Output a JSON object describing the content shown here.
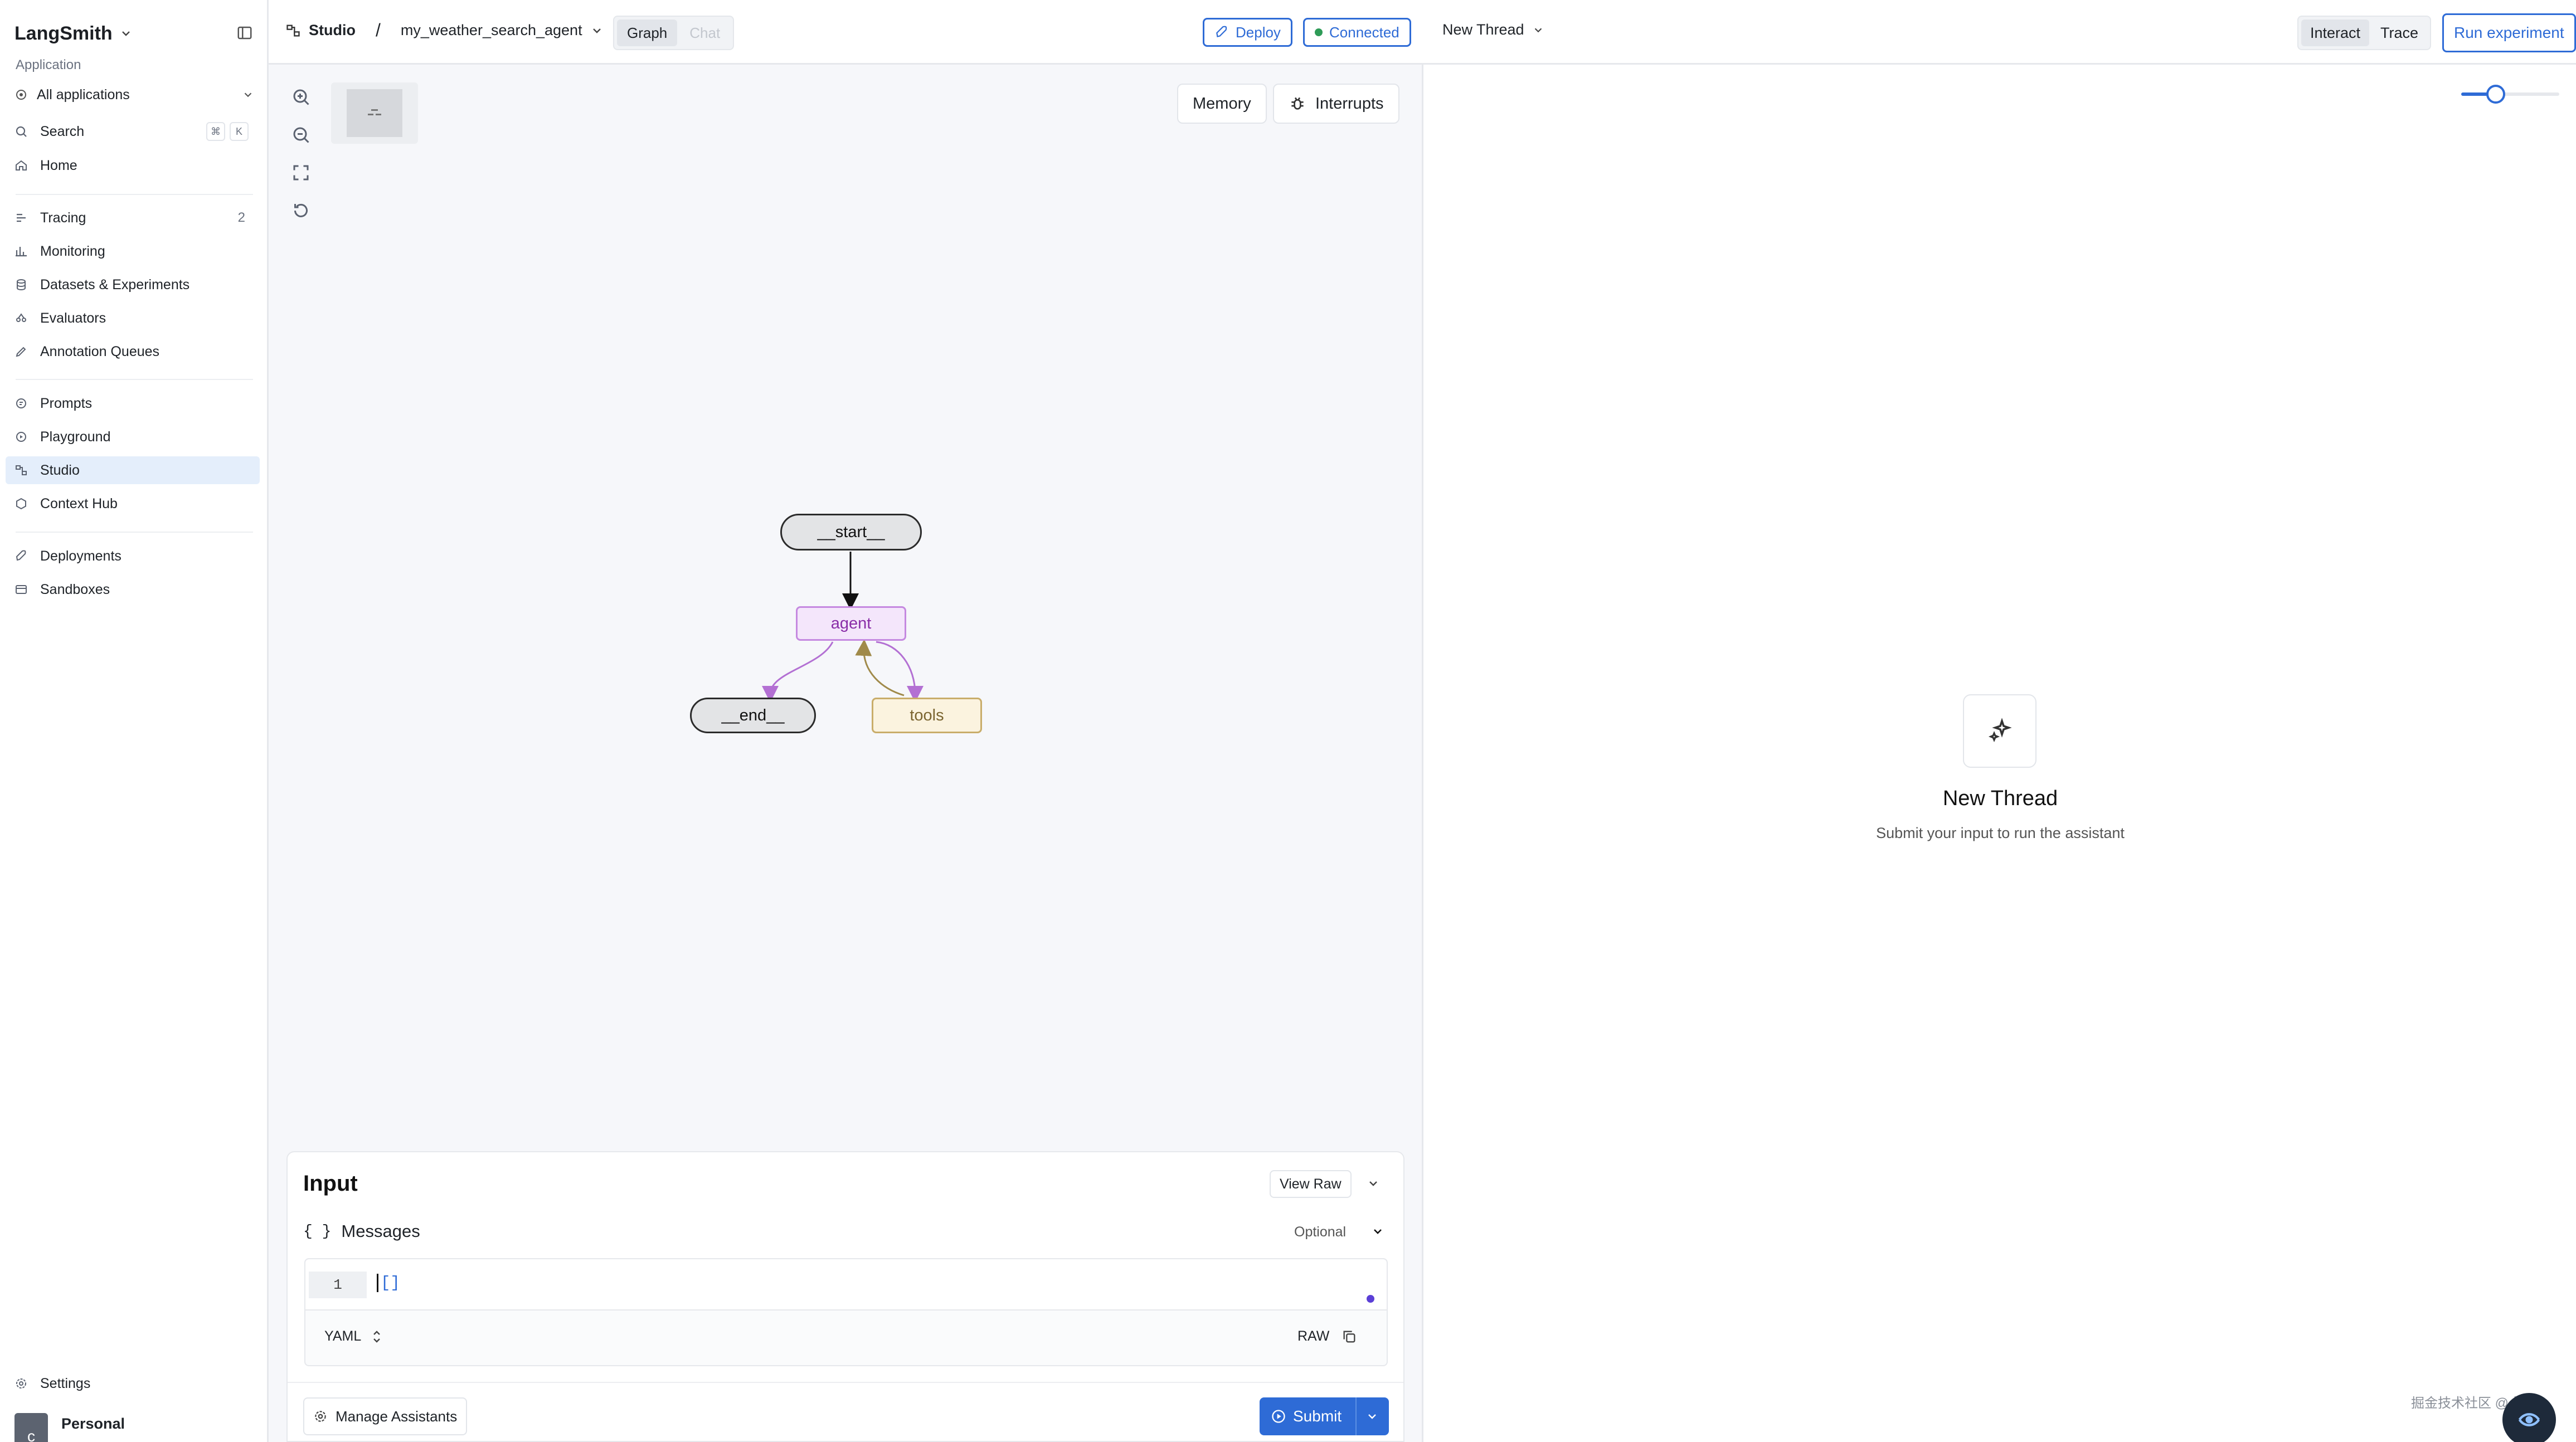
{
  "sidebar": {
    "brand": "LangSmith",
    "section_label": "Application",
    "app_selector": "All applications",
    "search": {
      "label": "Search",
      "kbd1": "⌘",
      "kbd2": "K"
    },
    "home": "Home",
    "tracing": {
      "label": "Tracing",
      "badge": "2"
    },
    "monitoring": "Monitoring",
    "datasets": "Datasets & Experiments",
    "evaluators": "Evaluators",
    "annotation": "Annotation Queues",
    "prompts": "Prompts",
    "playground": "Playground",
    "studio": "Studio",
    "context_hub": "Context Hub",
    "deployments": "Deployments",
    "sandboxes": "Sandboxes",
    "settings": "Settings",
    "user": {
      "avatar": "c",
      "name": "Personal"
    }
  },
  "topbar": {
    "studio_label": "Studio",
    "separator": "/",
    "graph_name": "my_weather_search_agent",
    "view_tabs": [
      "Graph",
      "Chat"
    ],
    "deploy": "Deploy",
    "status": "Connected",
    "status_color": "#2e9b57",
    "thread": "New Thread",
    "mode_tabs": [
      "Interact",
      "Trace"
    ],
    "run_experiment": "Run experiment"
  },
  "canvas": {
    "memory": "Memory",
    "interrupts": "Interrupts",
    "nodes": {
      "start": "__start__",
      "agent": "agent",
      "end": "__end__",
      "tools": "tools"
    }
  },
  "input_panel": {
    "title": "Input",
    "view_raw": "View Raw",
    "messages_icon": "{ }",
    "messages_label": "Messages",
    "optional": "Optional",
    "line_number": "1",
    "code": "[]",
    "format": "YAML",
    "raw": "RAW",
    "manage_assistants": "Manage Assistants",
    "submit": "Submit"
  },
  "right_pane": {
    "empty_title": "New Thread",
    "empty_subtitle": "Submit your input to run the assistant",
    "slider_value": 0.35,
    "watermark": "掘金技术社区 @ 梅塔"
  },
  "colors": {
    "accent": "#2e6bd6",
    "active_nav": "#e4eefb",
    "agent_border": "#c589e0",
    "tools_border": "#c9ad6a"
  }
}
